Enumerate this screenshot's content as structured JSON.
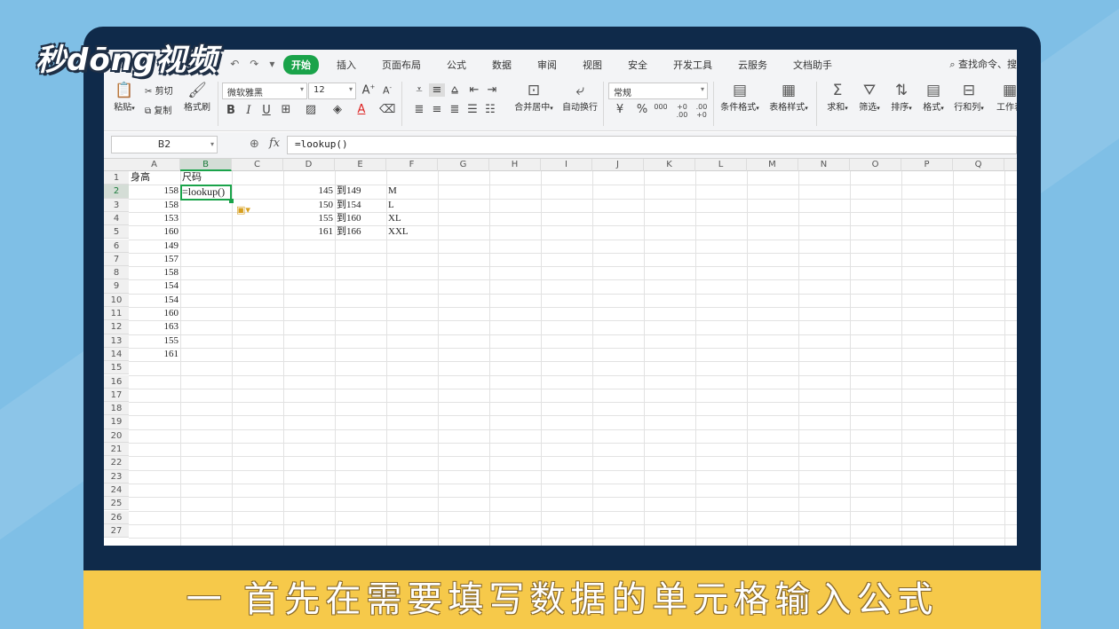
{
  "logo": {
    "text": "秒dōng视频"
  },
  "menu": {
    "items": [
      "开始",
      "插入",
      "页面布局",
      "公式",
      "数据",
      "审阅",
      "视图",
      "安全",
      "开发工具",
      "云服务",
      "文档助手"
    ],
    "active": "开始",
    "search": "查找命令、搜"
  },
  "ribbon": {
    "paste": "粘贴",
    "cut": "剪切",
    "copy": "复制",
    "format_painter": "格式刷",
    "font_name": "微软雅黑",
    "font_size": "12",
    "merge_center": "合并居中",
    "wrap_text": "自动换行",
    "number_format": "常规",
    "conditional_format": "条件格式",
    "table_style": "表格样式",
    "sum": "求和",
    "filter": "筛选",
    "sort": "排序",
    "format": "格式",
    "rows_cols": "行和列",
    "worksheet": "工作表",
    "bold": "B",
    "italic": "I",
    "underline": "U",
    "font_color": "A",
    "percent": "%",
    "thousands": "000",
    "inc_decimal": "+0 .00",
    "dec_decimal": ".00 +0"
  },
  "formula_bar": {
    "name_box": "B2",
    "fx": "fx",
    "formula": "=lookup()"
  },
  "sheet": {
    "columns": [
      "A",
      "B",
      "C",
      "D",
      "E",
      "F",
      "G",
      "H",
      "I",
      "J",
      "K",
      "L",
      "M",
      "N",
      "O",
      "P",
      "Q"
    ],
    "rows": [
      "1",
      "2",
      "3",
      "4",
      "5",
      "6",
      "7",
      "8",
      "9",
      "10",
      "11",
      "12",
      "13",
      "14",
      "15",
      "16",
      "17",
      "18",
      "19",
      "20",
      "21",
      "22",
      "23",
      "24",
      "25",
      "26",
      "27"
    ],
    "selected_cell": "B2",
    "header_a": "身高",
    "header_b": "尺码",
    "heights": [
      "158",
      "158",
      "153",
      "160",
      "149",
      "157",
      "158",
      "154",
      "154",
      "160",
      "163",
      "155",
      "161"
    ],
    "editing_text": "=lookup()",
    "ranges": [
      {
        "d": "145",
        "e": "到149",
        "f": "M"
      },
      {
        "d": "150",
        "e": "到154",
        "f": "L"
      },
      {
        "d": "155",
        "e": "到160",
        "f": "XL"
      },
      {
        "d": "161",
        "e": "到166",
        "f": "XXL"
      }
    ]
  },
  "caption": {
    "text": "一 首先在需要填写数据的单元格输入公式"
  }
}
